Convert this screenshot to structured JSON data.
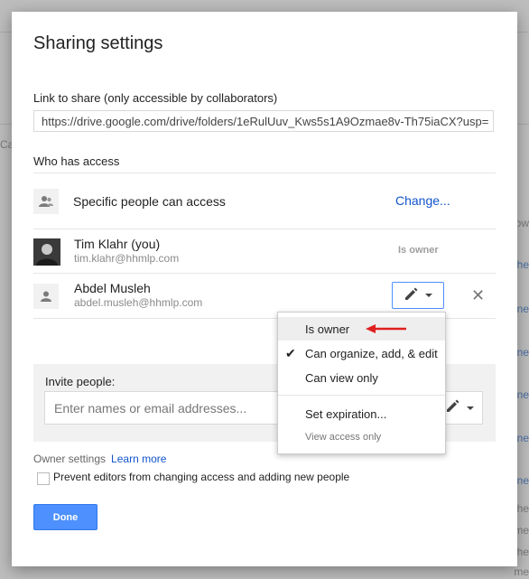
{
  "dialog": {
    "title": "Sharing settings",
    "link_label": "Link to share (only accessible by collaborators)",
    "link_value": "https://drive.google.com/drive/folders/1eRulUuv_Kws5s1A9Ozmae8v-Th75iaCX?usp=",
    "who_has_access": "Who has access",
    "access_setting": "Specific people can access",
    "change_link": "Change...",
    "people": [
      {
        "name": "Tim Klahr (you)",
        "email": "tim.klahr@hhmlp.com",
        "role": "Is owner"
      },
      {
        "name": "Abdel Musleh",
        "email": "abdel.musleh@hhmlp.com"
      }
    ],
    "remove_glyph": "✕",
    "invite_label": "Invite people:",
    "invite_placeholder": "Enter names or email addresses...",
    "owner_settings": "Owner settings",
    "learn_more": "Learn more",
    "prevent_editors": "Prevent editors from changing access and adding new people",
    "done": "Done"
  },
  "role_menu": {
    "items": [
      {
        "label": "Is owner",
        "highlighted": true
      },
      {
        "label": "Can organize, add, & edit",
        "checked": true
      },
      {
        "label": "Can view only"
      },
      {
        "label": "Set expiration..."
      },
      {
        "label": "View access only"
      }
    ],
    "check_glyph": "✔"
  },
  "background": {
    "edge_left": [
      "Ca"
    ],
    "edge_right": [
      "ow",
      "he",
      "ne",
      "ne",
      "ne",
      "ne",
      "ne",
      "he",
      "me",
      "he",
      "me"
    ]
  },
  "colors": {
    "accent": "#4d90fe",
    "link": "#1155cc",
    "annotation_arrow": "#e02020"
  }
}
